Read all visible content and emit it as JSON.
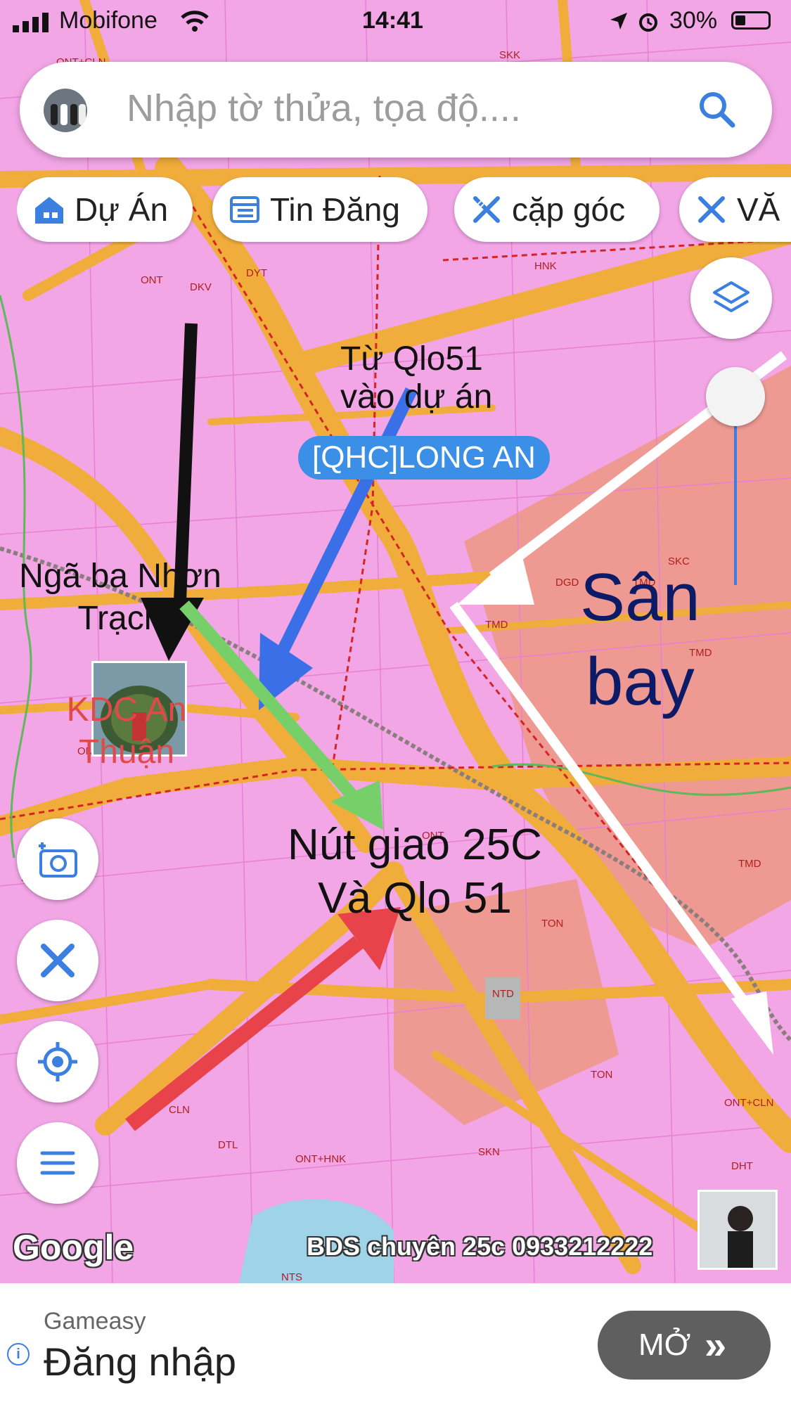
{
  "status_bar": {
    "carrier": "Mobifone",
    "time": "14:41",
    "battery": "30%"
  },
  "search": {
    "placeholder": "Nhập tờ thửa, tọa độ...."
  },
  "chips": [
    {
      "label": "Dự Án",
      "icon": "building-icon"
    },
    {
      "label": "Tin Đăng",
      "icon": "listing-icon"
    },
    {
      "label": "cặp góc",
      "icon": "ruler-pencil-icon"
    },
    {
      "label": "VĂ",
      "icon": "ruler-pencil-icon"
    }
  ],
  "map": {
    "annotations": {
      "qlo51_route": "Từ Qlo51\nvào dự án",
      "nga_ba": "Ngã ba Nhơn\nTrạch",
      "kdc": "KDC An\nThuận",
      "san_bay": "Sân\nbay",
      "nut_giao": "Nút giao 25C\nVà Qlo 51"
    },
    "project_pill": "[QHC]LONG AN",
    "watermark": "BDS chuyên 25c 0933212222",
    "attribution": "Google",
    "zone_codes": [
      "ONT",
      "ONT+CLN",
      "DHT",
      "DKV",
      "TMD",
      "SKC",
      "HNK",
      "DGD",
      "TON",
      "NTD",
      "SKN",
      "DTL",
      "CLN",
      "NTS",
      "DYT",
      "SKK",
      "ONT+HNK"
    ],
    "arrow_colors": {
      "black": "#111111",
      "blue": "#3a6fe8",
      "green": "#77cf6a",
      "red": "#e8424a",
      "white": "#ffffff"
    },
    "base_colors": {
      "land": "#f2a6e6",
      "road": "#f0ad3c",
      "airport": "#ee9a93"
    }
  },
  "ad": {
    "brand": "Gameasy",
    "title": "Đăng nhập",
    "button": "MỞ",
    "button_icon": "double-chevron-right-icon"
  }
}
